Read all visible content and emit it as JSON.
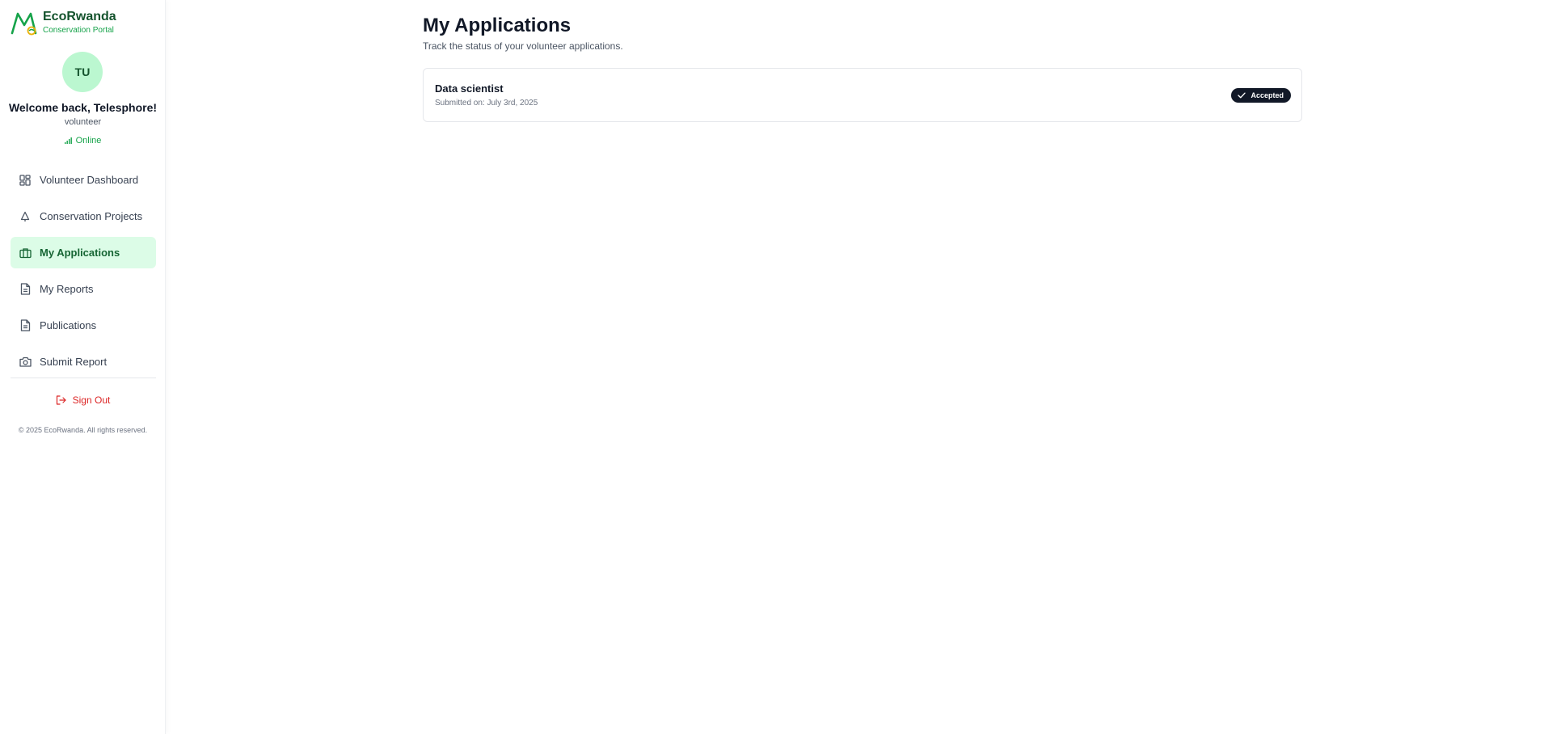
{
  "brand": {
    "name": "EcoRwanda",
    "subtitle": "Conservation Portal",
    "accent_color": "#16a34a",
    "dark_color": "#14532d"
  },
  "user": {
    "initials": "TU",
    "welcome": "Welcome back, Telesphore!",
    "role": "volunteer",
    "status": "Online"
  },
  "sidebar": {
    "items": [
      {
        "label": "Volunteer Dashboard",
        "icon": "dashboard-icon",
        "active": false
      },
      {
        "label": "Conservation Projects",
        "icon": "tree-icon",
        "active": false
      },
      {
        "label": "My Applications",
        "icon": "briefcase-icon",
        "active": true
      },
      {
        "label": "My Reports",
        "icon": "document-icon",
        "active": false
      },
      {
        "label": "Publications",
        "icon": "document-icon",
        "active": false
      },
      {
        "label": "Submit Report",
        "icon": "camera-icon",
        "active": false
      }
    ],
    "signout_label": "Sign Out",
    "copyright": "© 2025 EcoRwanda. All rights reserved."
  },
  "main": {
    "title": "My Applications",
    "subtitle": "Track the status of your volunteer applications.",
    "applications": [
      {
        "title": "Data scientist",
        "submitted": "Submitted on: July 3rd, 2025",
        "status": "Accepted",
        "status_icon": "check-icon"
      }
    ]
  }
}
